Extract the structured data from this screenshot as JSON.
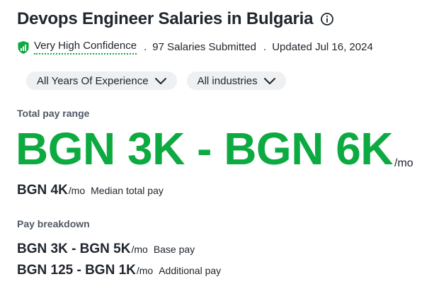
{
  "header": {
    "title": "Devops Engineer Salaries in Bulgaria",
    "info_icon": "info-circle-icon"
  },
  "meta": {
    "confidence_icon": "shield-bar-chart-icon",
    "confidence": "Very High Confidence",
    "sep1": ".",
    "salaries": "97 Salaries Submitted",
    "sep2": ".",
    "updated": "Updated Jul 16, 2024"
  },
  "filters": [
    {
      "label": "All Years Of Experience",
      "icon": "chevron-down-icon"
    },
    {
      "label": "All industries",
      "icon": "chevron-down-icon"
    }
  ],
  "total_pay": {
    "label": "Total pay range",
    "range": "BGN 3K - BGN 6K",
    "unit": "/mo",
    "median_value": "BGN 4K",
    "median_unit": "/mo",
    "median_label": "Median total pay"
  },
  "breakdown": {
    "label": "Pay breakdown",
    "items": [
      {
        "value": "BGN 3K - BGN 5K",
        "unit": "/mo",
        "label": "Base pay"
      },
      {
        "value": "BGN 125 - BGN 1K",
        "unit": "/mo",
        "label": "Additional pay"
      }
    ]
  },
  "colors": {
    "accent_green": "#0caa41",
    "text": "#20262e",
    "muted": "#505863",
    "pill_bg": "#eef0f2"
  }
}
